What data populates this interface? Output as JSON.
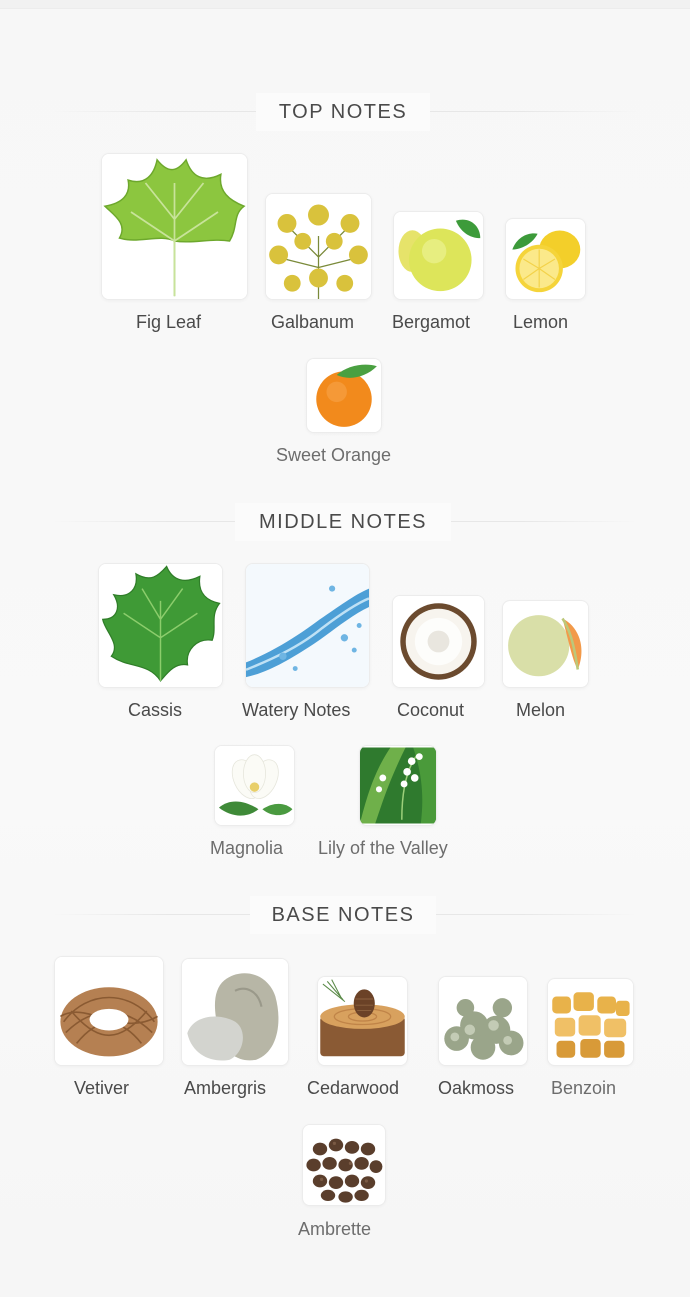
{
  "sections": {
    "top": {
      "title": "TOP NOTES",
      "items": [
        {
          "label": "Fig Leaf",
          "icon": "fig-leaf-icon"
        },
        {
          "label": "Galbanum",
          "icon": "galbanum-icon"
        },
        {
          "label": "Bergamot",
          "icon": "bergamot-icon"
        },
        {
          "label": "Lemon",
          "icon": "lemon-icon"
        },
        {
          "label": "Sweet Orange",
          "icon": "orange-icon"
        }
      ]
    },
    "middle": {
      "title": "MIDDLE NOTES",
      "items": [
        {
          "label": "Cassis",
          "icon": "cassis-leaf-icon"
        },
        {
          "label": "Watery Notes",
          "icon": "water-splash-icon"
        },
        {
          "label": "Coconut",
          "icon": "coconut-icon"
        },
        {
          "label": "Melon",
          "icon": "melon-icon"
        },
        {
          "label": "Magnolia",
          "icon": "magnolia-icon"
        },
        {
          "label": "Lily of the Valley",
          "icon": "lily-of-the-valley-icon"
        }
      ]
    },
    "base": {
      "title": "BASE NOTES",
      "items": [
        {
          "label": "Vetiver",
          "icon": "vetiver-icon"
        },
        {
          "label": "Ambergris",
          "icon": "ambergris-icon"
        },
        {
          "label": "Cedarwood",
          "icon": "cedarwood-icon"
        },
        {
          "label": "Oakmoss",
          "icon": "oakmoss-icon"
        },
        {
          "label": "Benzoin",
          "icon": "benzoin-icon"
        },
        {
          "label": "Ambrette",
          "icon": "ambrette-icon"
        }
      ]
    }
  }
}
